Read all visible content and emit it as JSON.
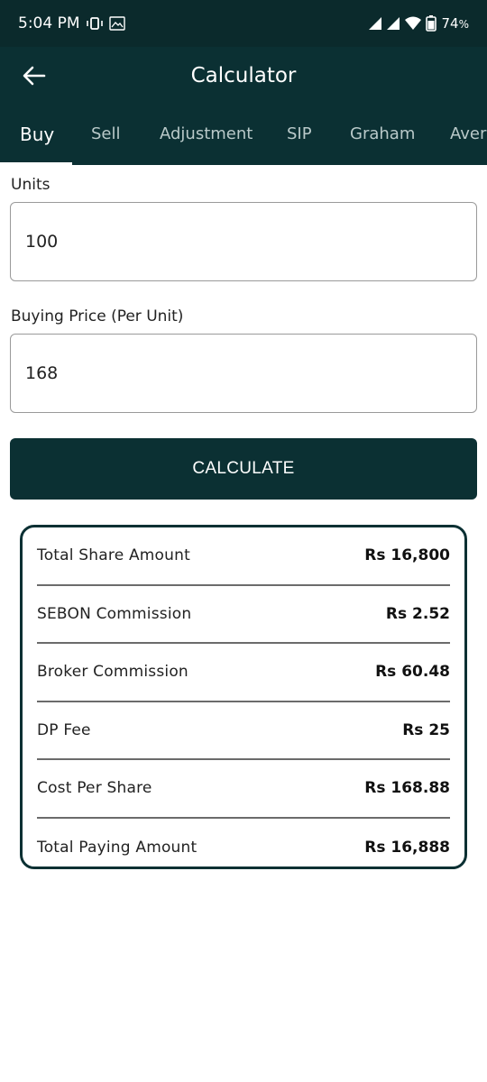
{
  "status_bar": {
    "time": "5:04 PM",
    "battery": "74",
    "battery_unit": "%",
    "icons": [
      "vibrate-icon",
      "gallery-icon",
      "signal-icon",
      "signal-icon",
      "wifi-icon",
      "battery-icon"
    ]
  },
  "app_bar": {
    "title": "Calculator",
    "back_icon": "arrow-left-icon"
  },
  "tabs": [
    {
      "label": "Buy",
      "active": true
    },
    {
      "label": "Sell",
      "active": false
    },
    {
      "label": "Adjustment",
      "active": false
    },
    {
      "label": "SIP",
      "active": false
    },
    {
      "label": "Graham",
      "active": false
    },
    {
      "label": "Average",
      "active": false
    }
  ],
  "form": {
    "units_label": "Units",
    "units_value": "100",
    "price_label": "Buying Price (Per Unit)",
    "price_value": "168",
    "calculate_label": "CALCULATE"
  },
  "results": [
    {
      "label": "Total Share Amount",
      "value": "Rs 16,800"
    },
    {
      "label": "SEBON Commission",
      "value": "Rs 2.52"
    },
    {
      "label": "Broker Commission",
      "value": "Rs 60.48"
    },
    {
      "label": "DP Fee",
      "value": "Rs 25"
    },
    {
      "label": "Cost Per Share",
      "value": "Rs 168.88"
    },
    {
      "label": "Total Paying Amount",
      "value": "Rs 16,888"
    }
  ],
  "colors": {
    "primary": "#0b3033",
    "status_bar": "#0b2a2c",
    "tab_inactive": "#b9c9c9"
  }
}
